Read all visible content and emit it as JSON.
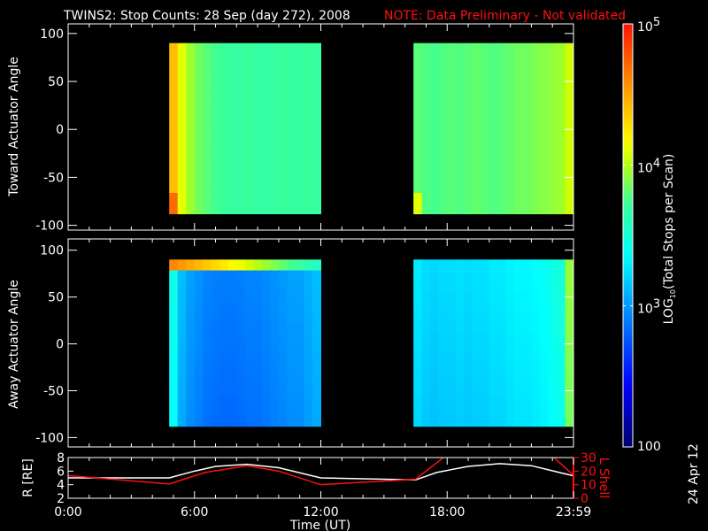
{
  "title": "TWINS2: Stop Counts: 28 Sep (day 272), 2008",
  "note": "NOTE: Data Preliminary - Not validated",
  "side_date": "24 Apr 12",
  "colors": {
    "background": "#000000",
    "axis": "#ffffff",
    "note": "#ff1010",
    "lshell": "#ff1010",
    "radius": "#ffffff"
  },
  "chart_data": [
    {
      "type": "heatmap",
      "name": "toward",
      "ylabel": "Toward Actuator Angle",
      "ylim": [
        -105,
        110
      ],
      "yticks": [
        "100",
        "50",
        "0",
        "-50",
        "-100"
      ],
      "ytick_values": [
        100,
        50,
        0,
        -50,
        -100
      ],
      "xlim_hours": [
        0,
        24
      ],
      "blocks": [
        {
          "start_h": 4.8,
          "end_h": 12.0,
          "angle_range": [
            -88,
            90
          ],
          "column_log10": [
            4.4,
            4.1,
            3.95,
            3.85,
            3.8,
            3.75,
            3.72,
            3.7,
            3.7,
            3.72,
            3.7,
            3.68,
            3.7,
            3.72,
            3.7,
            3.7,
            3.72,
            3.7
          ]
        },
        {
          "start_h": 16.4,
          "end_h": 24.0,
          "angle_range": [
            -88,
            90
          ],
          "column_log10": [
            3.8,
            3.78,
            3.76,
            3.78,
            3.8,
            3.78,
            3.8,
            3.82,
            3.8,
            3.78,
            3.8,
            3.82,
            3.85,
            3.85,
            3.88,
            3.9,
            3.92,
            3.95,
            4.05
          ]
        }
      ]
    },
    {
      "type": "heatmap",
      "name": "away",
      "ylabel": "Away Actuator Angle",
      "ylim": [
        -110,
        112
      ],
      "yticks": [
        "100",
        "50",
        "0",
        "-50",
        "-100"
      ],
      "ytick_values": [
        100,
        50,
        0,
        -50,
        -100
      ],
      "xlim_hours": [
        0,
        24
      ],
      "blocks": [
        {
          "start_h": 4.8,
          "end_h": 12.0,
          "angle_range": [
            -88,
            90
          ],
          "top_row_log10": 4.6,
          "column_log10": [
            3.4,
            3.1,
            3.0,
            2.95,
            2.9,
            2.88,
            2.87,
            2.87,
            2.88,
            2.9,
            2.9,
            2.92,
            2.95,
            2.97,
            3.0,
            3.0,
            3.05,
            3.1
          ]
        },
        {
          "start_h": 16.4,
          "end_h": 24.0,
          "angle_range": [
            -88,
            90
          ],
          "column_log10": [
            3.25,
            3.2,
            3.18,
            3.2,
            3.2,
            3.22,
            3.2,
            3.22,
            3.22,
            3.25,
            3.25,
            3.28,
            3.3,
            3.3,
            3.32,
            3.35,
            3.4,
            3.45,
            3.9
          ]
        }
      ]
    },
    {
      "type": "line",
      "name": "orbit",
      "xlabel": "Time (UT)",
      "xticks": [
        "0:00",
        "6:00",
        "12:00",
        "18:00",
        "23:59"
      ],
      "xtick_hours": [
        0,
        6,
        12,
        18,
        24
      ],
      "ylabel": "R [RE]",
      "yticks": [
        "8",
        "6",
        "4",
        "2"
      ],
      "ylim": [
        2,
        8
      ],
      "y2label": "L Shell",
      "y2ticks": [
        "30",
        "20",
        "10",
        "0"
      ],
      "y2lim": [
        0,
        30
      ],
      "series": [
        {
          "name": "R",
          "axis": "left",
          "x": [
            0,
            4.8,
            6,
            7,
            8.5,
            10,
            12,
            16.5,
            17.5,
            19,
            20.5,
            22,
            24
          ],
          "y": [
            5.0,
            5.0,
            6.0,
            6.7,
            7.0,
            6.5,
            5.0,
            4.7,
            5.8,
            6.7,
            7.1,
            6.8,
            5.3
          ]
        },
        {
          "name": "L Shell",
          "axis": "right",
          "x": [
            0,
            4.8,
            6.5,
            8.5,
            10,
            12,
            16.5,
            17.9,
            23.0,
            24
          ],
          "y": [
            16.7,
            10.5,
            19,
            24,
            20,
            10,
            14,
            31,
            31,
            17
          ]
        }
      ]
    }
  ],
  "colorbar": {
    "label": "LOG10(Total Stops per Scan)",
    "label_main": "LOG",
    "label_sub": "10",
    "label_rest": "(Total Stops per Scan)",
    "range_log10": [
      2,
      5
    ],
    "ticks": [
      {
        "base": "10",
        "exp": "5",
        "log10": 5
      },
      {
        "base": "10",
        "exp": "4",
        "log10": 4
      },
      {
        "base": "10",
        "exp": "3",
        "log10": 3
      }
    ],
    "bottom_label": "100"
  }
}
